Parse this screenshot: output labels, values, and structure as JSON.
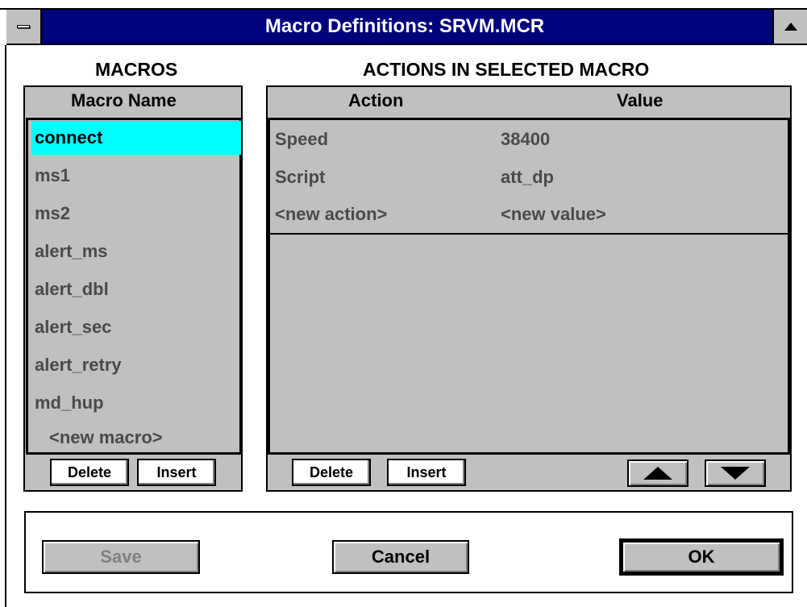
{
  "window": {
    "title": "Macro Definitions: SRVM.MCR"
  },
  "macros": {
    "heading": "MACROS",
    "column_header": "Macro Name",
    "items": [
      "connect",
      "ms1",
      "ms2",
      "alert_ms",
      "alert_dbl",
      "alert_sec",
      "alert_retry",
      "md_hup"
    ],
    "new_item": "<new macro>",
    "selected": "connect",
    "delete_label": "Delete",
    "insert_label": "Insert"
  },
  "actions": {
    "heading": "ACTIONS IN SELECTED MACRO",
    "col_action": "Action",
    "col_value": "Value",
    "rows": [
      {
        "action": "Speed",
        "value": "38400"
      },
      {
        "action": "Script",
        "value": "att_dp"
      },
      {
        "action": "<new action>",
        "value": "<new value>"
      }
    ],
    "delete_label": "Delete",
    "insert_label": "Insert"
  },
  "footer": {
    "save_label": "Save",
    "cancel_label": "Cancel",
    "ok_label": "OK"
  },
  "icons": {
    "system_menu": "system-menu-icon",
    "maximize": "maximize-icon",
    "move_up": "arrow-up-icon",
    "move_down": "arrow-down-icon"
  },
  "colors": {
    "titlebar": "#00007b",
    "selection": "#00ffff",
    "panel": "#c0c0c0"
  }
}
